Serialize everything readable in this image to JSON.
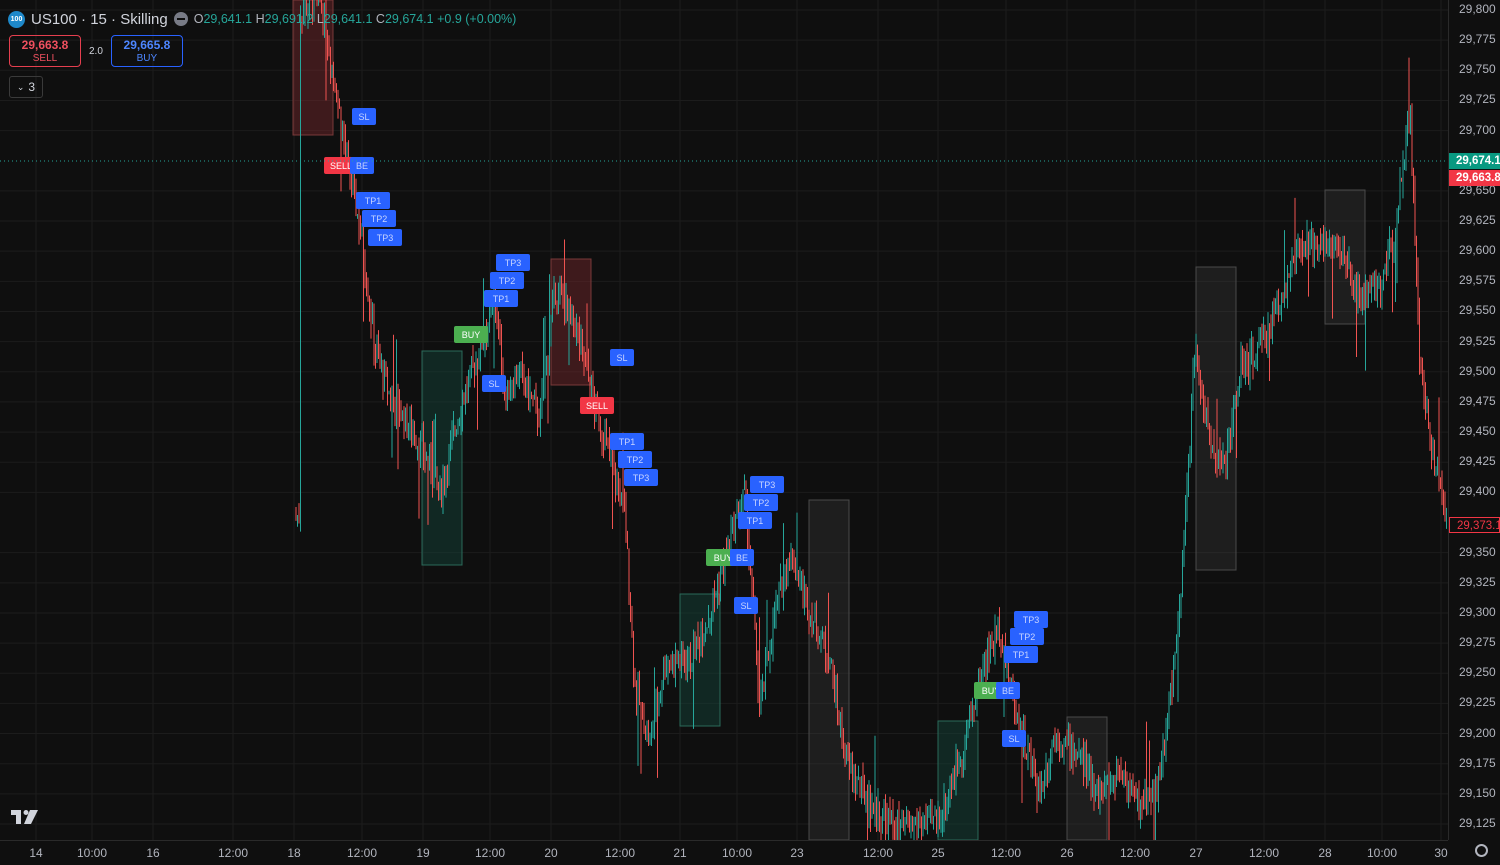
{
  "header": {
    "logo_text": "100",
    "title": "US100 · 15 · Skilling",
    "ohlc": {
      "o_label": "O",
      "o_value": "29,641.1",
      "h_label": "H",
      "h_value": "29,691.2",
      "l_label": "L",
      "l_value": "29,641.1",
      "c_label": "C",
      "c_value": "29,674.1",
      "change": "+0.9 (+0.00%)"
    }
  },
  "trade": {
    "sell_price": "29,663.8",
    "sell_label": "SELL",
    "spread": "2.0",
    "buy_price": "29,665.8",
    "buy_label": "BUY"
  },
  "collapse": {
    "count": "3"
  },
  "price_axis": {
    "ticks": [
      "29,800",
      "29,775",
      "29,750",
      "29,725",
      "29,700",
      "29,650",
      "29,625",
      "29,600",
      "29,575",
      "29,550",
      "29,525",
      "29,500",
      "29,475",
      "29,450",
      "29,425",
      "29,400",
      "29,350",
      "29,325",
      "29,300",
      "29,275",
      "29,250",
      "29,225",
      "29,200",
      "29,175",
      "29,150",
      "29,125"
    ],
    "last_price": "29,674.1",
    "bid_price": "29,663.8",
    "close_marker": "29,373.1"
  },
  "time_axis": {
    "ticks": [
      "14",
      "10:00",
      "16",
      "12:00",
      "18",
      "12:00",
      "19",
      "12:00",
      "20",
      "12:00",
      "21",
      "10:00",
      "23",
      "12:00",
      "25",
      "12:00",
      "26",
      "12:00",
      "27",
      "12:00",
      "28",
      "10:00",
      "30"
    ]
  },
  "colors": {
    "up": "#26a69a",
    "down": "#ef5350",
    "background": "#0f0f0f",
    "label_blue": "#2962ff",
    "label_red": "#f23645",
    "label_green": "#4caf50"
  },
  "chart_data": {
    "type": "candlestick",
    "symbol": "US100",
    "interval": "15",
    "ylim": [
      29100,
      29810
    ],
    "x": [
      "14",
      "16",
      "18",
      "19",
      "20",
      "21",
      "23",
      "25",
      "26",
      "27",
      "28",
      "30"
    ],
    "trend_points": [
      {
        "x": "18",
        "y": 29800
      },
      {
        "x": "18",
        "y": 29640
      },
      {
        "x": "18",
        "y": 29500
      },
      {
        "x": "19",
        "y": 29460
      },
      {
        "x": "19",
        "y": 29540
      },
      {
        "x": "20",
        "y": 29520
      },
      {
        "x": "20",
        "y": 29420
      },
      {
        "x": "21",
        "y": 29230
      },
      {
        "x": "21",
        "y": 29400
      },
      {
        "x": "23",
        "y": 29330
      },
      {
        "x": "23",
        "y": 29150
      },
      {
        "x": "25",
        "y": 29150
      },
      {
        "x": "25",
        "y": 29300
      },
      {
        "x": "26",
        "y": 29170
      },
      {
        "x": "26",
        "y": 29150
      },
      {
        "x": "27",
        "y": 29480
      },
      {
        "x": "27",
        "y": 29550
      },
      {
        "x": "28",
        "y": 29620
      },
      {
        "x": "28",
        "y": 29560
      },
      {
        "x": "30",
        "y": 29740
      },
      {
        "x": "30",
        "y": 29400
      }
    ],
    "signal_labels": [
      "SL",
      "SELL",
      "BE",
      "TP1",
      "TP2",
      "TP3",
      "TP3",
      "TP2",
      "TP1",
      "BUY",
      "SL",
      "SL",
      "SELL",
      "TP1",
      "TP2",
      "TP3",
      "TP3",
      "TP2",
      "TP1",
      "BUY",
      "BE",
      "SL",
      "TP3",
      "TP2",
      "TP1",
      "BUY",
      "BE",
      "SL"
    ]
  }
}
